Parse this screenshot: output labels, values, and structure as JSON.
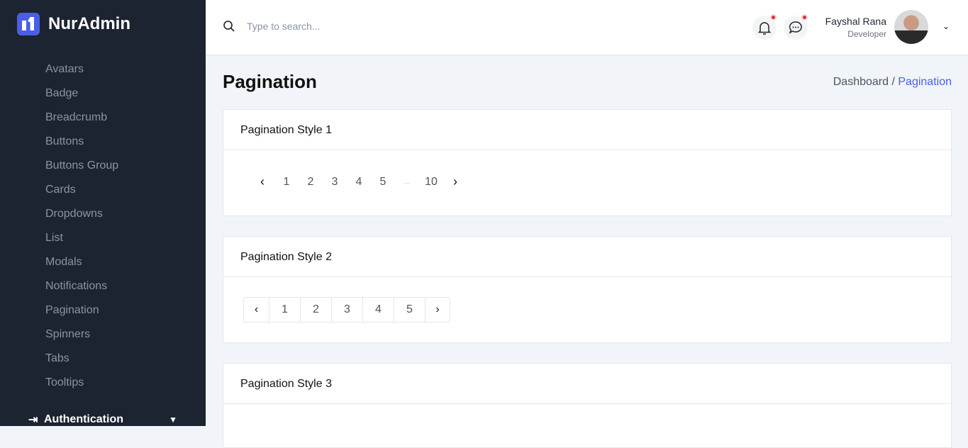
{
  "brand": "NurAdmin",
  "sidebar": {
    "items": [
      "Avatars",
      "Badge",
      "Breadcrumb",
      "Buttons",
      "Buttons Group",
      "Cards",
      "Dropdowns",
      "List",
      "Modals",
      "Notifications",
      "Pagination",
      "Spinners",
      "Tabs",
      "Tooltips"
    ],
    "section": "Authentication"
  },
  "topbar": {
    "search_placeholder": "Type to search...",
    "user_name": "Fayshal Rana",
    "user_role": "Developer"
  },
  "page": {
    "title": "Pagination",
    "breadcrumb": [
      "Dashboard /",
      "Pagination"
    ]
  },
  "cards": [
    {
      "title": "Pagination Style 1",
      "pages": [
        "1",
        "2",
        "3",
        "4",
        "5",
        "...",
        "10"
      ]
    },
    {
      "title": "Pagination Style 2",
      "pages": [
        "1",
        "2",
        "3",
        "4",
        "5"
      ]
    },
    {
      "title": "Pagination Style 3"
    }
  ],
  "colors": {
    "accent": "#4a5ee8",
    "sidebar": "#1c2331"
  }
}
